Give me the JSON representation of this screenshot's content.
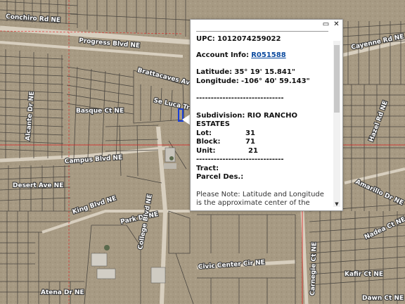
{
  "map": {
    "street_labels": [
      {
        "id": "concha",
        "text": "Conchiro Rd NE"
      },
      {
        "id": "progress",
        "text": "Progress Blvd NE"
      },
      {
        "id": "cayenne",
        "text": "Cayenne Rd NE"
      },
      {
        "id": "bratt",
        "text": "Brattacaves Av NE"
      },
      {
        "id": "sage",
        "text": "Se Luca Tr NE"
      },
      {
        "id": "basque",
        "text": "Basque Ct NE"
      },
      {
        "id": "alcante",
        "text": "Alcante Dr NE"
      },
      {
        "id": "campus",
        "text": "Campus Blvd NE"
      },
      {
        "id": "desert",
        "text": "Desert Ave NE"
      },
      {
        "id": "king",
        "text": "King Blvd NE"
      },
      {
        "id": "park",
        "text": "Park Dr NE"
      },
      {
        "id": "college",
        "text": "College Blvd NE"
      },
      {
        "id": "civic",
        "text": "Civic Center Cir NE"
      },
      {
        "id": "kafir",
        "text": "Kafir Ct NE"
      },
      {
        "id": "dawn",
        "text": "Dawn Ct NE"
      },
      {
        "id": "atena",
        "text": "Atena Dr NE"
      },
      {
        "id": "hazel",
        "text": "Hazel Rd NE"
      },
      {
        "id": "amarillo",
        "text": "Amarillo Dr NE"
      },
      {
        "id": "nadea",
        "text": "Nadea Ct NE"
      },
      {
        "id": "carnegie",
        "text": "Carnegie Ct NE"
      }
    ],
    "colors": {
      "lot_lines": "#4a4640",
      "grid_lines": "#e02020",
      "selected_parcel": "#1a3fd6"
    }
  },
  "popup": {
    "upc_label": "UPC:",
    "upc_value": "1012074259022",
    "account_label": "Account Info:",
    "account_link": "R051588",
    "latitude_label": "Latitude:",
    "latitude_value": "35° 19' 15.841\"",
    "longitude_label": "Longitude:",
    "longitude_value": "-106° 40' 59.143\"",
    "divider": "------------------------------",
    "subdivision_label": "Subdivision:",
    "subdivision_value": "RIO RANCHO",
    "subdivision_value_2": "ESTATES",
    "lot_label": "Lot:",
    "lot_value": "31",
    "block_label": "Block:",
    "block_value": "71",
    "unit_label": "Unit:",
    "unit_value": "21",
    "tract_label": "Tract:",
    "parcel_des_label": "Parcel Des.:",
    "note": "Please Note: Latitude and Longitude is the approximate center of the parcel shown.",
    "controls": {
      "maximize_icon": "maximize-icon",
      "close_icon": "close-icon",
      "close_glyph": "✕",
      "maximize_glyph": "▭"
    }
  }
}
